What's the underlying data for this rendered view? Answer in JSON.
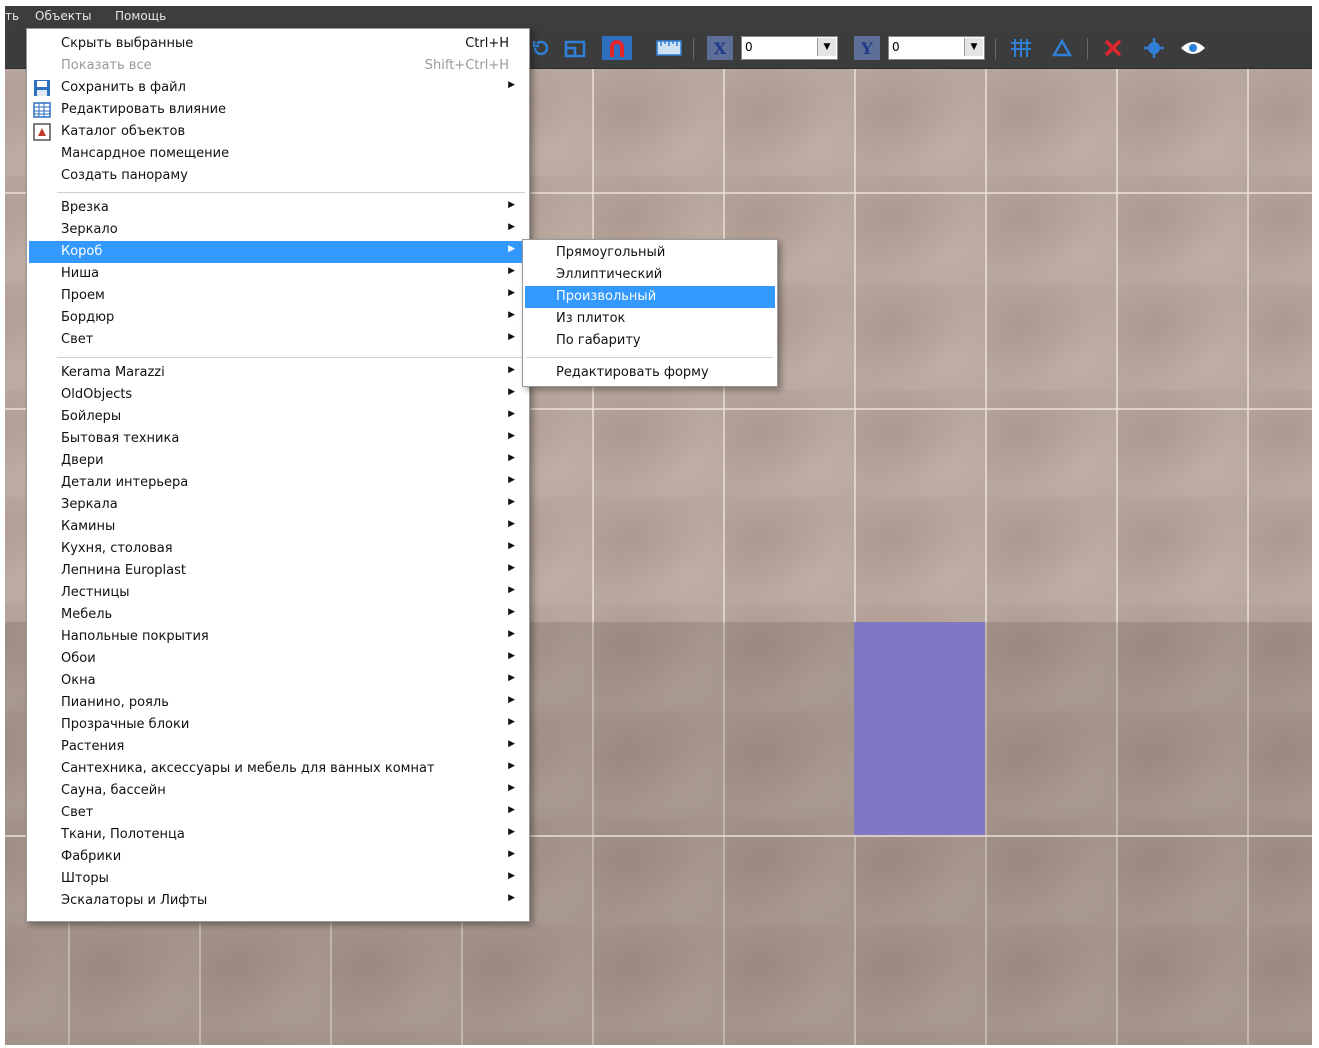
{
  "menubar": {
    "items": [
      "ть",
      "Объекты",
      "Помощь"
    ]
  },
  "toolbar": {
    "x_label": "X",
    "x_value": "0",
    "y_label": "Y",
    "y_value": "0",
    "icons": [
      "rotate-icon",
      "resize-icon",
      "magnet-icon",
      "ruler-icon",
      "grid-icon",
      "triangle-icon",
      "delete-icon",
      "center-icon",
      "eye-icon"
    ],
    "colors": {
      "accent_blue": "#3399ff",
      "magnet_red": "#e0262b",
      "icon_blue": "#2f7fd6"
    }
  },
  "main_menu": {
    "items": [
      {
        "label": "Скрыть выбранные",
        "shortcut": "Ctrl+H"
      },
      {
        "label": "Показать все",
        "shortcut": "Shift+Ctrl+H",
        "disabled": true
      },
      {
        "label": "Сохранить в файл",
        "icon": "save-icon",
        "submenu": true
      },
      {
        "label": "Редактировать влияние",
        "icon": "table-icon"
      },
      {
        "label": "Каталог объектов",
        "icon": "catalog-icon"
      },
      {
        "label": "Мансардное помещение"
      },
      {
        "label": "Создать панораму"
      },
      {
        "label": "Врезка",
        "submenu": true
      },
      {
        "label": "Зеркало",
        "submenu": true
      },
      {
        "label": "Короб",
        "submenu": true,
        "selected": true
      },
      {
        "label": "Ниша",
        "submenu": true
      },
      {
        "label": "Проем",
        "submenu": true
      },
      {
        "label": "Бордюр",
        "submenu": true
      },
      {
        "label": "Свет",
        "submenu": true
      },
      {
        "label": "Kerama Marazzi",
        "submenu": true
      },
      {
        "label": "OldObjects",
        "submenu": true
      },
      {
        "label": "Бойлеры",
        "submenu": true
      },
      {
        "label": "Бытовая техника",
        "submenu": true
      },
      {
        "label": "Двери",
        "submenu": true
      },
      {
        "label": "Детали интерьера",
        "submenu": true
      },
      {
        "label": "Зеркала",
        "submenu": true
      },
      {
        "label": "Камины",
        "submenu": true
      },
      {
        "label": "Кухня, столовая",
        "submenu": true
      },
      {
        "label": "Лепнина Europlast",
        "submenu": true
      },
      {
        "label": "Лестницы",
        "submenu": true
      },
      {
        "label": "Мебель",
        "submenu": true
      },
      {
        "label": "Напольные покрытия",
        "submenu": true
      },
      {
        "label": "Обои",
        "submenu": true
      },
      {
        "label": "Окна",
        "submenu": true
      },
      {
        "label": "Пианино, рояль",
        "submenu": true
      },
      {
        "label": "Прозрачные блоки",
        "submenu": true
      },
      {
        "label": "Растения",
        "submenu": true
      },
      {
        "label": "Сантехника, аксессуары и мебель для ванных комнат",
        "submenu": true
      },
      {
        "label": "Сауна, бассейн",
        "submenu": true
      },
      {
        "label": "Свет",
        "submenu": true
      },
      {
        "label": "Ткани, Полотенца",
        "submenu": true
      },
      {
        "label": "Фабрики",
        "submenu": true
      },
      {
        "label": "Шторы",
        "submenu": true
      },
      {
        "label": "Эскалаторы и Лифты",
        "submenu": true
      }
    ]
  },
  "sub_menu": {
    "items": [
      {
        "label": "Прямоугольный"
      },
      {
        "label": "Эллиптический"
      },
      {
        "label": "Произвольный",
        "selected": true
      },
      {
        "label": "Из плиток"
      },
      {
        "label": "По габариту"
      },
      {
        "label": "Редактировать форму"
      }
    ]
  }
}
